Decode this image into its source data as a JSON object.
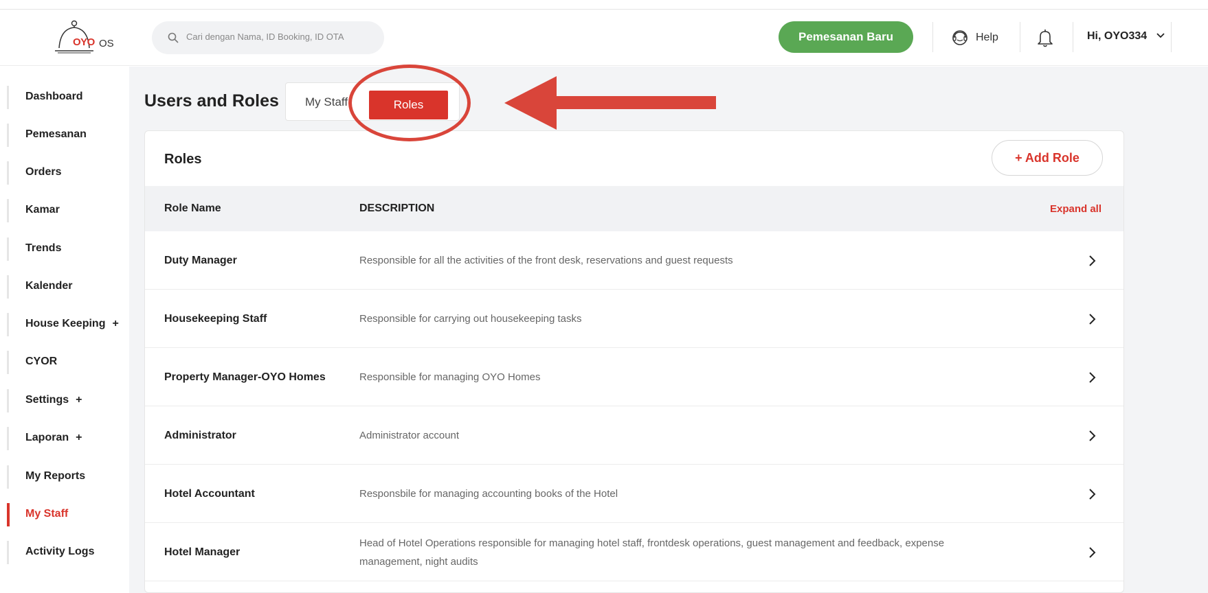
{
  "header": {
    "logo_text": "OYO",
    "logo_suffix": "OS",
    "search_placeholder": "Cari dengan Nama, ID Booking, ID OTA",
    "new_booking_label": "Pemesanan Baru",
    "help_label": "Help",
    "user_label": "Hi, OYO334"
  },
  "sidebar": {
    "items": [
      {
        "label": "Dashboard",
        "plus": ""
      },
      {
        "label": "Pemesanan",
        "plus": ""
      },
      {
        "label": "Orders",
        "plus": ""
      },
      {
        "label": "Kamar",
        "plus": ""
      },
      {
        "label": "Trends",
        "plus": ""
      },
      {
        "label": "Kalender",
        "plus": ""
      },
      {
        "label": "House Keeping",
        "plus": "+"
      },
      {
        "label": "CYOR",
        "plus": ""
      },
      {
        "label": "Settings",
        "plus": "+"
      },
      {
        "label": "Laporan",
        "plus": "+"
      },
      {
        "label": "My Reports",
        "plus": ""
      },
      {
        "label": "My Staff",
        "plus": "",
        "active": true
      },
      {
        "label": "Activity Logs",
        "plus": ""
      }
    ]
  },
  "main": {
    "page_title": "Users and Roles",
    "tabs": [
      {
        "label": "My Staff"
      },
      {
        "label": "Roles",
        "active": true
      }
    ],
    "card_title": "Roles",
    "add_role_label": "+  Add Role",
    "columns": {
      "name": "Role Name",
      "description": "DESCRIPTION",
      "expand": "Expand all"
    },
    "rows": [
      {
        "name": "Duty Manager",
        "description": "Responsible for all the activities of the front desk, reservations and guest requests"
      },
      {
        "name": "Housekeeping Staff",
        "description": "Responsible for carrying out housekeeping tasks"
      },
      {
        "name": "Property Manager-OYO Homes",
        "description": "Responsible for managing OYO Homes"
      },
      {
        "name": "Administrator",
        "description": "Administrator account"
      },
      {
        "name": "Hotel Accountant",
        "description": "Responsbile for managing accounting books of the Hotel"
      },
      {
        "name": "Hotel Manager",
        "description": "Head of Hotel Operations responsible for managing hotel staff, frontdesk operations, guest management and feedback, expense management, night audits"
      }
    ]
  },
  "colors": {
    "brand_red": "#d9342b",
    "new_booking_green": "#5aa854",
    "annotation_red": "#d9453a"
  },
  "icons": [
    "search-icon",
    "help-icon",
    "bell-icon",
    "chevron-down-icon",
    "chevron-right-icon"
  ]
}
